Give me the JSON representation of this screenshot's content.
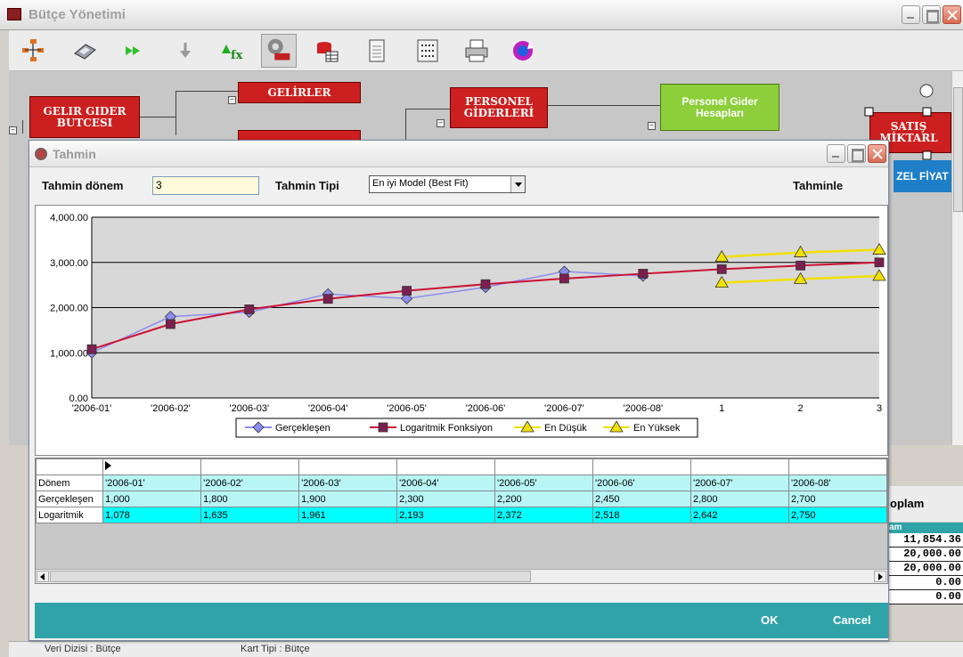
{
  "main_window": {
    "title": "Bütçe Yönetimi"
  },
  "canvas": {
    "nodes": {
      "gelir_gider": "GELIR GIDER BUTCESI",
      "gelirler": "GELİRLER",
      "personel": "PERSONEL GİDERLERİ",
      "personel_hesap": "Personel Gider Hesapları",
      "satis": "SATIŞ MİKTARL",
      "ozel_fiyat": "ZEL FİYAT"
    }
  },
  "behind": {
    "total_label": "oplam",
    "col_label": "am",
    "values": [
      "11,854.36",
      "20,000.00",
      "20,000.00",
      "0.00",
      "0.00"
    ]
  },
  "status": {
    "veri_dizisi": "Veri Dizisi : Bütçe",
    "kart_tipi": "Kart Tipi : Bütçe"
  },
  "dialog": {
    "title": "Tahmin",
    "period_label": "Tahmin dönem",
    "period_value": "3",
    "type_label": "Tahmin Tipi",
    "type_value": "En iyi Model (Best Fit)",
    "forecast_button": "Tahminle",
    "ok": "OK",
    "cancel": "Cancel"
  },
  "chart_data": {
    "type": "line",
    "categories": [
      "'2006-01'",
      "'2006-02'",
      "'2006-03'",
      "'2006-04'",
      "'2006-05'",
      "'2006-06'",
      "'2006-07'",
      "'2006-08'",
      "1",
      "2",
      "3"
    ],
    "ylim": [
      0,
      4000
    ],
    "yticks": [
      "0.00",
      "1,000.00",
      "2,000.00",
      "3,000.00",
      "4,000.00"
    ],
    "grid": true,
    "legend": "bottom",
    "series": [
      {
        "name": "Gerçekleşen",
        "color": "#8c8cf0",
        "marker": "diamond",
        "values": [
          1000,
          1800,
          1900,
          2300,
          2200,
          2450,
          2800,
          2700,
          null,
          null,
          null
        ]
      },
      {
        "name": "Logaritmik Fonksiyon",
        "color": "#cc1133",
        "marker": "square",
        "values": [
          1078,
          1635,
          1961,
          2193,
          2372,
          2518,
          2642,
          2750,
          2850,
          2930,
          3000
        ]
      },
      {
        "name": "En Düşük",
        "color": "#f0e000",
        "marker": "triangle",
        "values": [
          null,
          null,
          null,
          null,
          null,
          null,
          null,
          null,
          2550,
          2630,
          2700
        ]
      },
      {
        "name": "En Yüksek",
        "color": "#f0e000",
        "marker": "triangle",
        "values": [
          null,
          null,
          null,
          null,
          null,
          null,
          null,
          null,
          3120,
          3220,
          3280
        ]
      }
    ]
  },
  "grid": {
    "rows": [
      {
        "label": "Dönem",
        "cells": [
          "'2006-01'",
          "'2006-02'",
          "'2006-03'",
          "'2006-04'",
          "'2006-05'",
          "'2006-06'",
          "'2006-07'",
          "'2006-08'"
        ]
      },
      {
        "label": "Gerçekleşen",
        "cells": [
          "1,000",
          "1,800",
          "1,900",
          "2,300",
          "2,200",
          "2,450",
          "2,800",
          "2,700"
        ]
      },
      {
        "label": "Logaritmik",
        "cells": [
          "1,078",
          "1,635",
          "1,961",
          "2,193",
          "2,372",
          "2,518",
          "2,642",
          "2,750"
        ]
      }
    ]
  }
}
